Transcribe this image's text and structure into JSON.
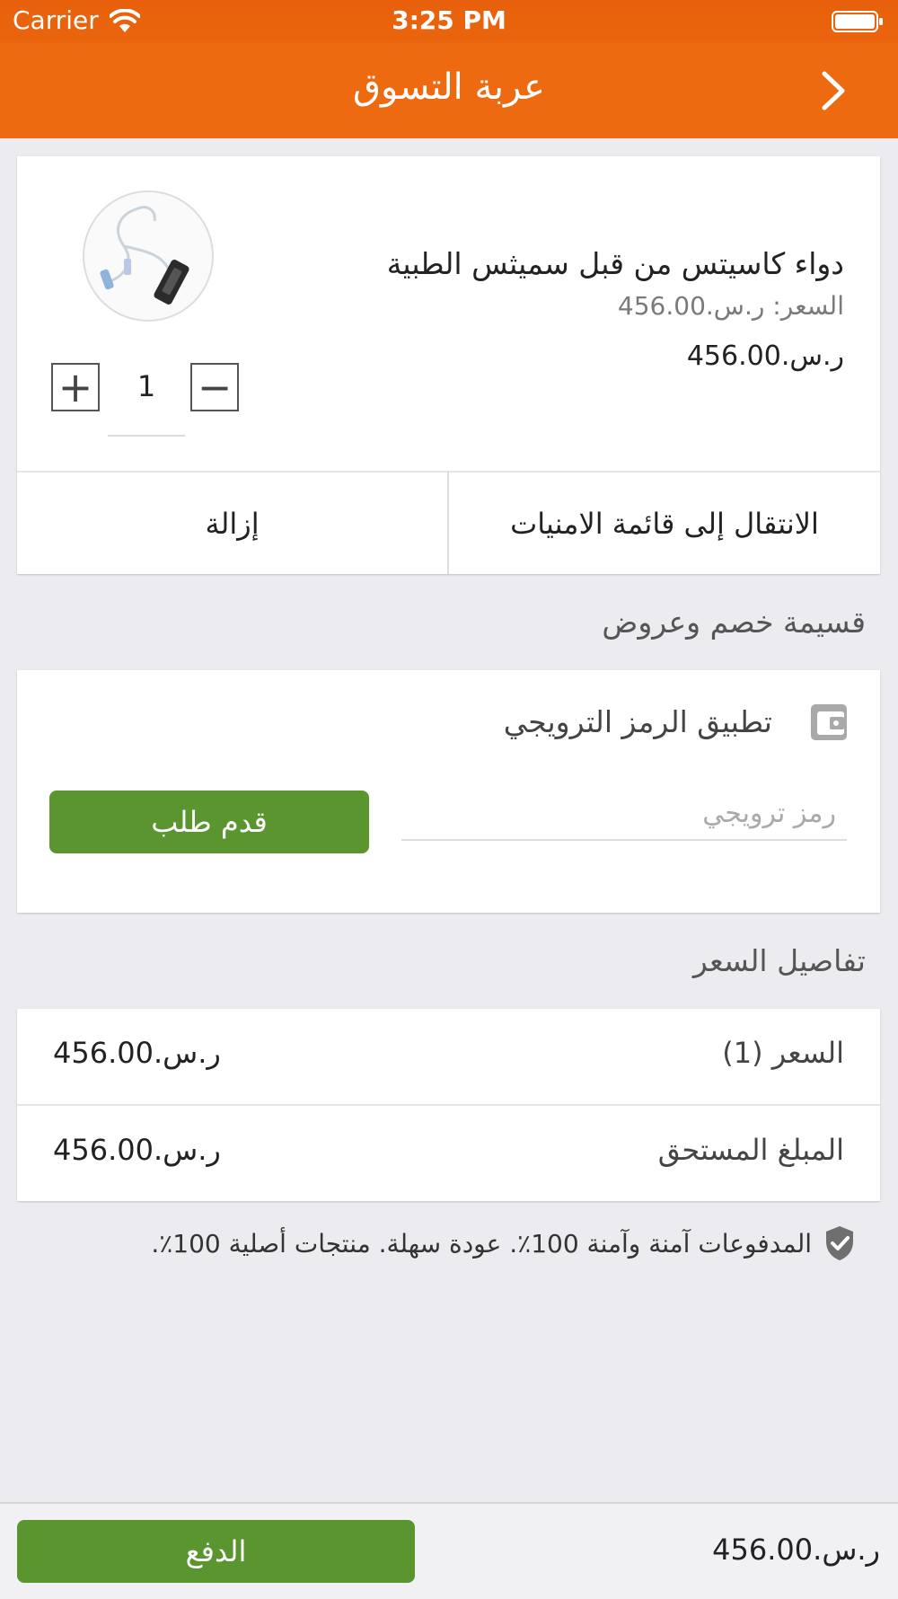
{
  "status_bar": {
    "carrier": "Carrier",
    "time": "3:25 PM"
  },
  "header": {
    "title": "عربة التسوق",
    "back_icon": "chevron-right-icon"
  },
  "product": {
    "name": "دواء كاسيتس من قبل سميثس الطبية",
    "unit_price": "السعر: ر.س.456.00",
    "total": "ر.س.456.00",
    "quantity": "1",
    "move_to_wishlist_label": "الانتقال إلى قائمة الامنيات",
    "remove_label": "إزالة"
  },
  "coupons_section": {
    "title": "قسيمة خصم وعروض"
  },
  "promo": {
    "label": "تطبيق الرمز الترويجي",
    "input_placeholder": "رمز ترويجي",
    "apply_label": "قدم طلب",
    "icon": "wallet-icon"
  },
  "price_section": {
    "title": "تفاصيل السعر"
  },
  "price_details": [
    {
      "label": "السعر (1)",
      "value": "ر.س.456.00"
    },
    {
      "label": "المبلغ المستحق",
      "value": "ر.س.456.00"
    }
  ],
  "secure_note": "المدفوعات آمنة وآمنة 100٪. عودة سهلة. منتجات أصلية 100٪.",
  "bottom_bar": {
    "total": "ر.س.456.00",
    "pay_label": "الدفع"
  },
  "colors": {
    "brand_orange": "#ee6a10",
    "action_green": "#5a952f",
    "background": "#ebebf0"
  }
}
